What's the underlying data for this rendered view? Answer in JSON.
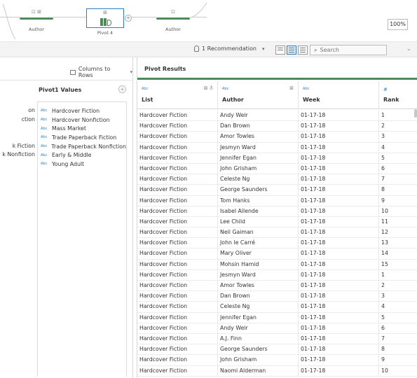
{
  "flow": {
    "nodes": [
      {
        "name": "Author"
      },
      {
        "name": "Pivot 4"
      },
      {
        "name": "Author"
      }
    ],
    "zoom": "100%"
  },
  "toolbar": {
    "recommendations": "1 Recommendation",
    "search_placeholder": "Search"
  },
  "left_panel": {
    "columns_to_rows": "Columns to Rows",
    "pivot_values_title": "Pivot1 Values",
    "cut_off_items": [
      "on",
      "ction",
      "",
      "",
      "k Fiction",
      "k Nonfiction"
    ],
    "pivot_values": [
      "Hardcover Fiction",
      "Hardcover Nonfiction",
      "Mass Market",
      "Trade Paperback Fiction",
      "Trade Paperback Nonfiction",
      "Early & Middle",
      "Young Adult"
    ],
    "type_label": "Abc"
  },
  "results": {
    "title": "Pivot Results",
    "columns": [
      {
        "type": "Abc",
        "name": "List"
      },
      {
        "type": "Abc",
        "name": "Author"
      },
      {
        "type": "Abc",
        "name": "Week"
      },
      {
        "type": "#",
        "name": "Rank"
      }
    ],
    "rows": [
      [
        "Hardcover Fiction",
        "Andy Weir",
        "01-17-18",
        "1"
      ],
      [
        "Hardcover Fiction",
        "Dan Brown",
        "01-17-18",
        "2"
      ],
      [
        "Hardcover Fiction",
        "Amor Towles",
        "01-17-18",
        "3"
      ],
      [
        "Hardcover Fiction",
        "Jesmyn Ward",
        "01-17-18",
        "4"
      ],
      [
        "Hardcover Fiction",
        "Jennifer Egan",
        "01-17-18",
        "5"
      ],
      [
        "Hardcover Fiction",
        "John Grisham",
        "01-17-18",
        "6"
      ],
      [
        "Hardcover Fiction",
        "Celeste Ng",
        "01-17-18",
        "7"
      ],
      [
        "Hardcover Fiction",
        "George Saunders",
        "01-17-18",
        "8"
      ],
      [
        "Hardcover Fiction",
        "Tom Hanks",
        "01-17-18",
        "9"
      ],
      [
        "Hardcover Fiction",
        "Isabel Allende",
        "01-17-18",
        "10"
      ],
      [
        "Hardcover Fiction",
        "Lee Child",
        "01-17-18",
        "11"
      ],
      [
        "Hardcover Fiction",
        "Neil Gaiman",
        "01-17-18",
        "12"
      ],
      [
        "Hardcover Fiction",
        "John le Carré",
        "01-17-18",
        "13"
      ],
      [
        "Hardcover Fiction",
        "Mary Oliver",
        "01-17-18",
        "14"
      ],
      [
        "Hardcover Fiction",
        "Mohsin Hamid",
        "01-17-18",
        "15"
      ],
      [
        "Hardcover Fiction",
        "Jesmyn Ward",
        "01-17-18",
        "1"
      ],
      [
        "Hardcover Fiction",
        "Amor Towles",
        "01-17-18",
        "2"
      ],
      [
        "Hardcover Fiction",
        "Dan Brown",
        "01-17-18",
        "3"
      ],
      [
        "Hardcover Fiction",
        "Celeste Ng",
        "01-17-18",
        "4"
      ],
      [
        "Hardcover Fiction",
        "Jennifer Egan",
        "01-17-18",
        "5"
      ],
      [
        "Hardcover Fiction",
        "Andy Weir",
        "01-17-18",
        "6"
      ],
      [
        "Hardcover Fiction",
        "A.J. Finn",
        "01-17-18",
        "7"
      ],
      [
        "Hardcover Fiction",
        "George Saunders",
        "01-17-18",
        "8"
      ],
      [
        "Hardcover Fiction",
        "John Grisham",
        "01-17-18",
        "9"
      ],
      [
        "Hardcover Fiction",
        "Naomi Alderman",
        "01-17-18",
        "10"
      ]
    ]
  },
  "colors": {
    "accent": "#2f7fbf",
    "step_green": "#4f8a5b"
  }
}
